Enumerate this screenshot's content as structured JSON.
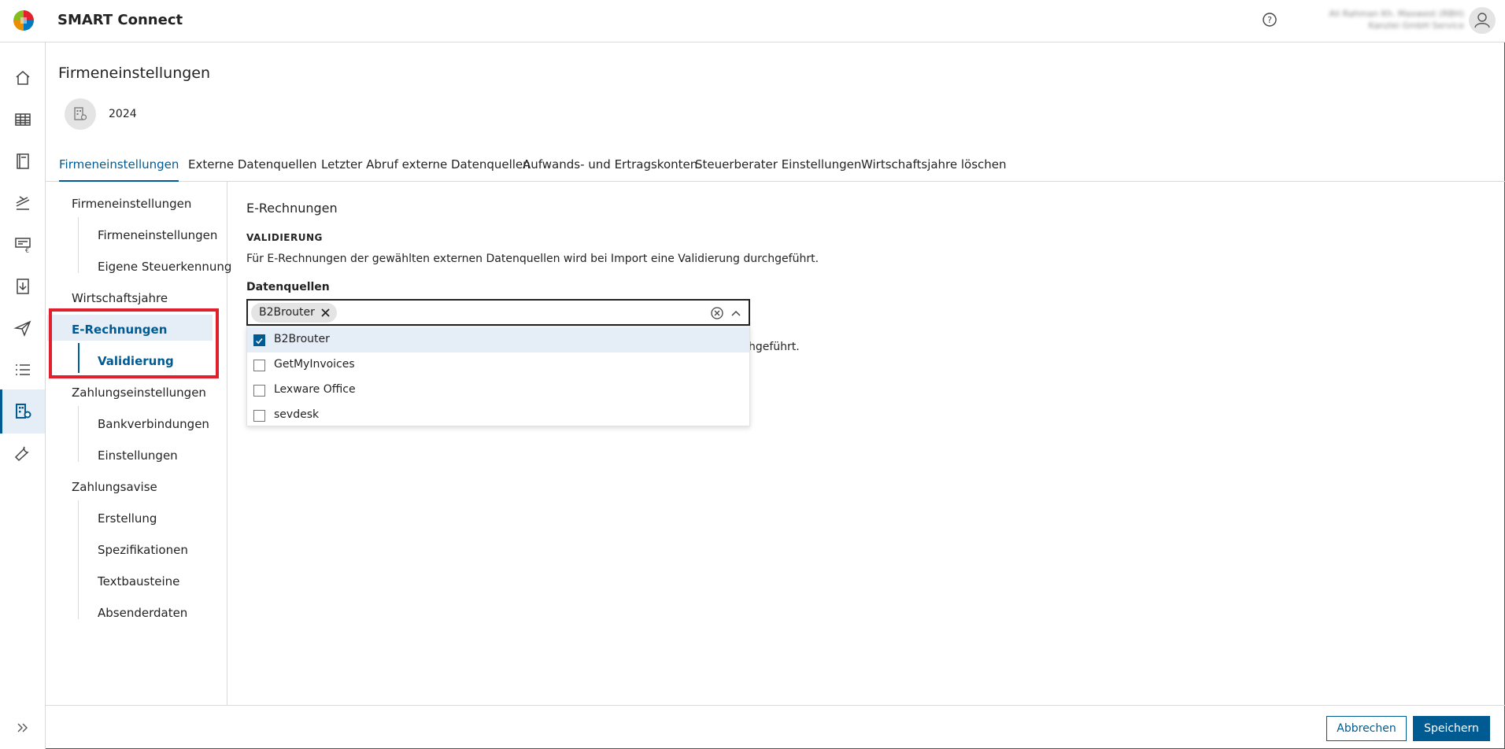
{
  "app": {
    "title": "SMART Connect",
    "user_line1": "Ali Rahman Kh. Maxwest (RBH)",
    "user_line2": "Kanzlei GmbH Service"
  },
  "colors": {
    "accent": "#005b92",
    "highlight": "#e0202d",
    "selected_bg": "#e5eef6"
  },
  "rail": {
    "items": [
      {
        "icon": "home-icon"
      },
      {
        "icon": "table-icon"
      },
      {
        "icon": "book-icon"
      },
      {
        "icon": "stack-icon"
      },
      {
        "icon": "invoice-euro-icon"
      },
      {
        "icon": "download-doc-icon"
      },
      {
        "icon": "send-icon"
      },
      {
        "icon": "list-icon"
      },
      {
        "icon": "company-settings-icon",
        "active": true
      },
      {
        "icon": "wrench-icon"
      }
    ],
    "expand_icon": "chevron-double-right-icon"
  },
  "page": {
    "title": "Firmeneinstellungen",
    "year": "2024"
  },
  "tabs": [
    {
      "label": "Firmeneinstellungen",
      "active": true
    },
    {
      "label": "Externe Datenquellen"
    },
    {
      "label": "Letzter Abruf externe Datenquellen"
    },
    {
      "label": "Aufwands- und Ertragskonten"
    },
    {
      "label": "Steuerberater Einstellungen"
    },
    {
      "label": "Wirtschaftsjahre löschen"
    }
  ],
  "subnav": {
    "groups": [
      {
        "label": "Firmeneinstellungen",
        "children": [
          "Firmeneinstellungen",
          "Eigene Steuerkennung"
        ]
      },
      {
        "label": "Wirtschaftsjahre",
        "children": []
      },
      {
        "label": "E-Rechnungen",
        "children": [
          "Validierung"
        ],
        "active": true
      },
      {
        "label": "Zahlungseinstellungen",
        "children": [
          "Bankverbindungen",
          "Einstellungen"
        ]
      },
      {
        "label": "Zahlungsavise",
        "children": [
          "Erstellung",
          "Spezifikationen",
          "Textbausteine",
          "Absenderdaten"
        ]
      }
    ]
  },
  "content": {
    "title": "E-Rechnungen",
    "section_label": "VALIDIERUNG",
    "description": "Für E-Rechnungen der gewählten externen Datenquellen wird bei Import eine Validierung durchgeführt.",
    "hidden_tail": "hgeführt.",
    "field_label": "Datenquellen",
    "selected_chip": "B2Brouter",
    "options": [
      {
        "label": "B2Brouter",
        "checked": true
      },
      {
        "label": "GetMyInvoices",
        "checked": false
      },
      {
        "label": "Lexware Office",
        "checked": false
      },
      {
        "label": "sevdesk",
        "checked": false
      }
    ]
  },
  "footer": {
    "cancel_label": "Abbrechen",
    "save_label": "Speichern"
  }
}
